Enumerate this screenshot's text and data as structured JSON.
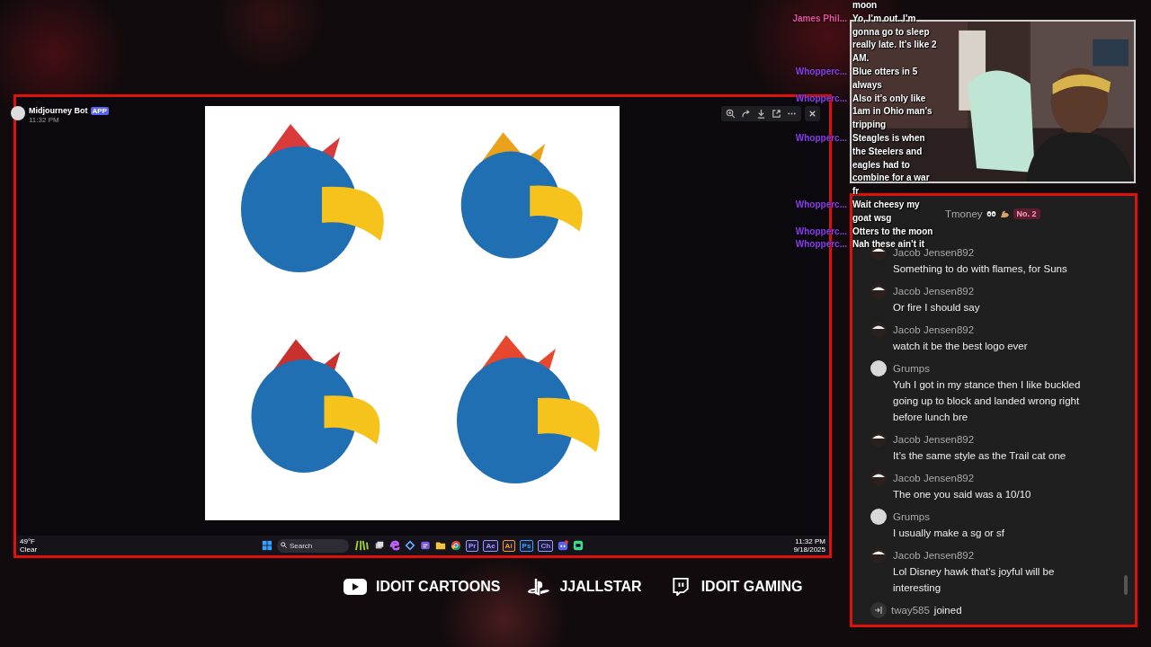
{
  "screen_window": {
    "header": {
      "author": "Midjourney Bot",
      "badge": "APP",
      "time": "11:32 PM"
    },
    "taskbar": {
      "weather": {
        "temperature": "49°F",
        "condition": "Clear"
      },
      "search": {
        "placeholder": "Search"
      },
      "apps": [
        {
          "kind": "windows"
        },
        {
          "kind": "bamboo"
        },
        {
          "kind": "taskview"
        },
        {
          "kind": "swirl"
        },
        {
          "kind": "diamond"
        },
        {
          "kind": "notes"
        },
        {
          "kind": "folder"
        },
        {
          "kind": "browser"
        },
        {
          "kind": "letters",
          "label": "Pr",
          "color": "#9999ff"
        },
        {
          "kind": "letters",
          "label": "Ae",
          "color": "#9999ff"
        },
        {
          "kind": "letters",
          "label": "Ai",
          "color": "#ff9a00"
        },
        {
          "kind": "letters",
          "label": "Ps",
          "color": "#31a8ff"
        },
        {
          "kind": "letters",
          "label": "Ch",
          "color": "#9999ff"
        },
        {
          "kind": "controller"
        },
        {
          "kind": "chat"
        }
      ],
      "clock": {
        "time": "11:32 PM",
        "date": "9/18/2025"
      }
    }
  },
  "overlay_chat": [
    {
      "text": "moon"
    },
    {
      "author": "James Phil...",
      "color": "#e0559c",
      "text": "Yo, I’m out. I’m gonna go to sleep really late. It’s like 2 AM."
    },
    {
      "author": "Whopperc...",
      "color": "#8b3df2",
      "text": "Blue otters in 5 always"
    },
    {
      "author": "Whopperc...",
      "color": "#8b3df2",
      "text": "Also it’s only like 1am in Ohio man’s tripping"
    },
    {
      "author": "Whopperc...",
      "color": "#8b3df2",
      "text": "Steagles is when the Steelers and eagles had to combine for a war fr"
    },
    {
      "author": "Whopperc...",
      "color": "#8b3df2",
      "text": "Wait cheesy my goat wsg"
    },
    {
      "author": "Whopperc...",
      "color": "#8b3df2",
      "text": "Otters to the moon"
    },
    {
      "author": "Whopperc...",
      "color": "#8b3df2",
      "text": "Nah these ain’t it"
    }
  ],
  "chat_panel": {
    "messages": [
      {
        "kind": "ranked",
        "author": "Tmoney",
        "badge": "No. 2"
      },
      {
        "author": "Jacob Jensen892",
        "text": "Something to do with flames, for Suns"
      },
      {
        "author": "Jacob Jensen892",
        "text": "Or fire I should say"
      },
      {
        "author": "Jacob Jensen892",
        "text": "watch it be the best logo ever"
      },
      {
        "kind": "plain",
        "author": "Grumps",
        "text": "Yuh I got in my stance then I like buckled going up to block and landed wrong right before lunch bre"
      },
      {
        "author": "Jacob Jensen892",
        "text": "It’s the same style as the Trail cat one"
      },
      {
        "author": "Jacob Jensen892",
        "text": "The one you said was a 10/10"
      },
      {
        "kind": "plain",
        "author": "Grumps",
        "text": "I usually make a sg or sf"
      },
      {
        "author": "Jacob Jensen892",
        "text": "Lol Disney hawk that’s joyful will be interesting"
      }
    ],
    "joined": {
      "user": "tway585",
      "text": "joined"
    }
  },
  "socials": [
    {
      "kind": "youtube",
      "label": "IDOIT CARTOONS"
    },
    {
      "kind": "playstation",
      "label": "JJALLSTAR"
    },
    {
      "kind": "twitch",
      "label": "IDOIT GAMING"
    }
  ]
}
